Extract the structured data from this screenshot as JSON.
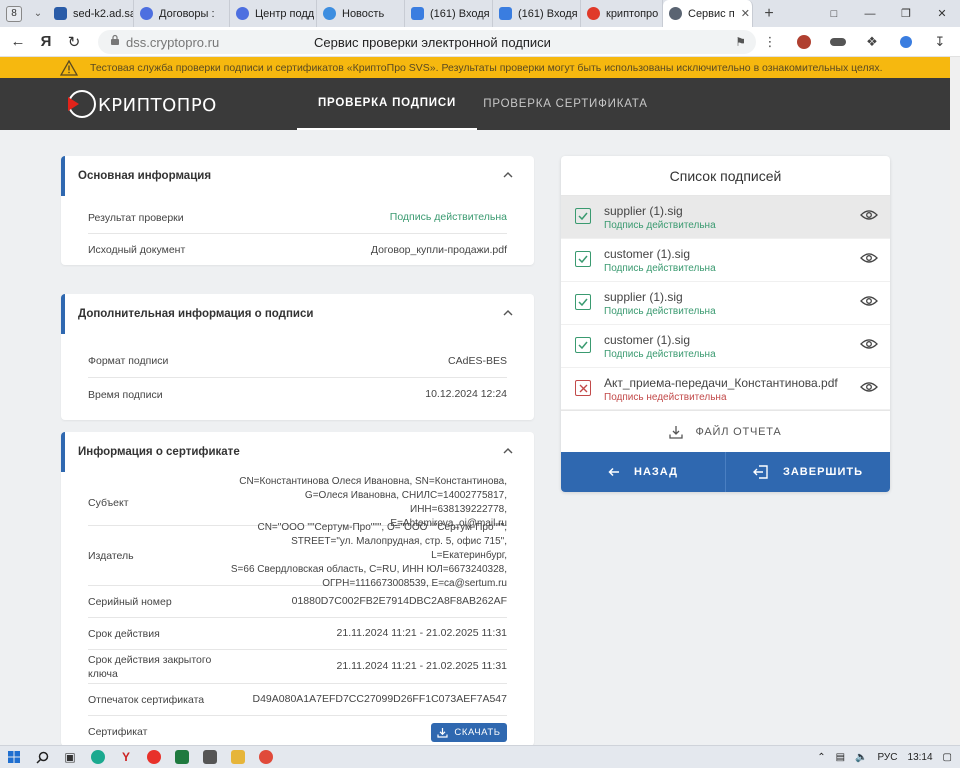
{
  "browser": {
    "tab_count": "8",
    "tabs": [
      {
        "title": "sed-k2.ad.sa",
        "color": "#2a5ca8"
      },
      {
        "title": "Договоры :",
        "color": "#4d6fe0"
      },
      {
        "title": "Центр подд",
        "color": "#4d6fe0"
      },
      {
        "title": "Новость",
        "color": "#3d8ee0"
      },
      {
        "title": "(161) Входя",
        "color": "#3a7de0"
      },
      {
        "title": "(161) Входя",
        "color": "#3a7de0"
      },
      {
        "title": "криптопро",
        "color": "#e03a2a"
      },
      {
        "title": "Сервис п",
        "color": "#5a6472"
      }
    ],
    "url_host": "dss.cryptopro.ru",
    "page_title": "Сервис проверки электронной подписи"
  },
  "warning": {
    "text": "Тестовая служба проверки подписи и сертификатов «КриптоПро SVS». Результаты проверки могут быть использованы исключительно в ознакомительных целях."
  },
  "header": {
    "logo_text": "КРИПТОПРО",
    "nav": {
      "verify_signature": "ПРОВЕРКА ПОДПИСИ",
      "verify_certificate": "ПРОВЕРКА СЕРТИФИКАТА"
    }
  },
  "basic_info": {
    "title": "Основная информация",
    "rows": [
      {
        "label": "Результат проверки",
        "value": "Подпись действительна"
      },
      {
        "label": "Исходный документ",
        "value": "Договор_купли-продажи.pdf"
      }
    ]
  },
  "extra_info": {
    "title": "Дополнительная информация о подписи",
    "rows": [
      {
        "label": "Формат подписи",
        "value": "CAdES-BES"
      },
      {
        "label": "Время подписи",
        "value": "10.12.2024 12:24"
      }
    ]
  },
  "cert_info": {
    "title": "Информация о сертификате",
    "rows": [
      {
        "label": "Субъект",
        "value_lines": [
          "CN=Константинова Олеся Ивановна, SN=Константинова,",
          "G=Олеся Ивановна, СНИЛС=14002775817, ИНН=638139222778,",
          "E=Ahtemirova_oi@mail.ru"
        ]
      },
      {
        "label": "Издатель",
        "value_lines": [
          "CN=\"ООО \"\"Сертум-Про\"\"\", O=\"ООО \"\"Сертум-Про\"\"\",",
          "STREET=\"ул. Малопрудная, стр. 5, офис 715\", L=Екатеринбург,",
          "S=66 Свердловская область, C=RU, ИНН ЮЛ=6673240328,",
          "ОГРН=1116673008539, E=ca@sertum.ru"
        ]
      },
      {
        "label": "Серийный номер",
        "value": "01880D7C002FB2E7914DBC2A8F8AB262AF"
      },
      {
        "label": "Срок действия",
        "value": "21.11.2024 11:21 - 21.02.2025 11:31"
      },
      {
        "label": "Срок действия закрытого ключа",
        "value": "21.11.2024 11:21 - 21.02.2025 11:31"
      },
      {
        "label": "Отпечаток сертификата",
        "value": "D49A080A1A7EFD7CC27099D26FF1C073AEF7A547"
      },
      {
        "label": "Сертификат"
      }
    ],
    "download_label": "СКАЧАТЬ"
  },
  "signatures": {
    "title": "Список подписей",
    "items": [
      {
        "name": "supplier (1).sig",
        "status": "Подпись действительна",
        "valid": true
      },
      {
        "name": "customer (1).sig",
        "status": "Подпись действительна",
        "valid": true
      },
      {
        "name": "supplier (1).sig",
        "status": "Подпись действительна",
        "valid": true
      },
      {
        "name": "customer (1).sig",
        "status": "Подпись действительна",
        "valid": true
      },
      {
        "name": "Акт_приема-передачи_Константинова.pdf",
        "status": "Подпись недействительна",
        "valid": false
      }
    ],
    "report_label": "ФАЙЛ ОТЧЕТА",
    "back_label": "НАЗАД",
    "finish_label": "ЗАВЕРШИТЬ"
  },
  "colors": {
    "accent": "#2f68b0",
    "valid": "#3a9a70",
    "invalid": "#c24a4a",
    "warning_bg": "#f6b80f",
    "header_bg": "#3a3a3a"
  },
  "taskbar": {
    "lang": "РУС",
    "time": "13:14"
  }
}
